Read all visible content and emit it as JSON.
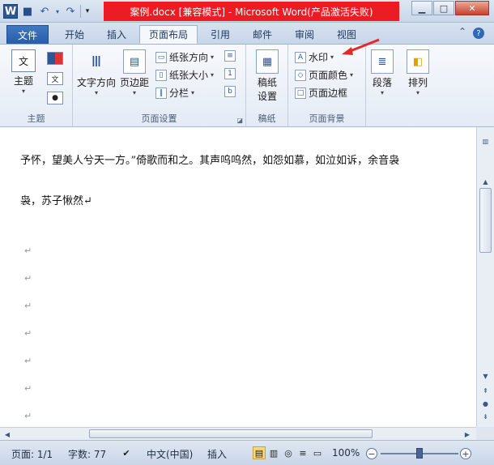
{
  "window": {
    "title": "案例.docx [兼容模式] - Microsoft Word(产品激活失败)"
  },
  "tabs": [
    "文件",
    "开始",
    "插入",
    "页面布局",
    "引用",
    "邮件",
    "审阅",
    "视图"
  ],
  "ribbon": {
    "theme_group": {
      "button": "主题",
      "label": "主题"
    },
    "page_setup": {
      "text_direction": "文字方向",
      "margins": "页边距",
      "orientation": "纸张方向",
      "size": "纸张大小",
      "columns": "分栏",
      "label": "页面设置"
    },
    "manuscript": {
      "button_line1": "稿纸",
      "button_line2": "设置",
      "label": "稿纸"
    },
    "page_background": {
      "watermark": "水印",
      "page_color": "页面颜色",
      "page_borders": "页面边框",
      "label": "页面背景"
    },
    "paragraph": "段落",
    "arrange": "排列"
  },
  "document": {
    "line1": "予怀，望美人兮天一方。”倚歌而和之。其声呜呜然，如怨如慕，如泣如诉，余音袅",
    "line2": "袅，苏子愀然↵",
    "para_mark": "↵"
  },
  "status": {
    "page": "页面: 1/1",
    "words": "字数: 77",
    "language": "中文(中国)",
    "mode": "插入",
    "zoom": "100%"
  },
  "annotation_color": "#e8262b"
}
